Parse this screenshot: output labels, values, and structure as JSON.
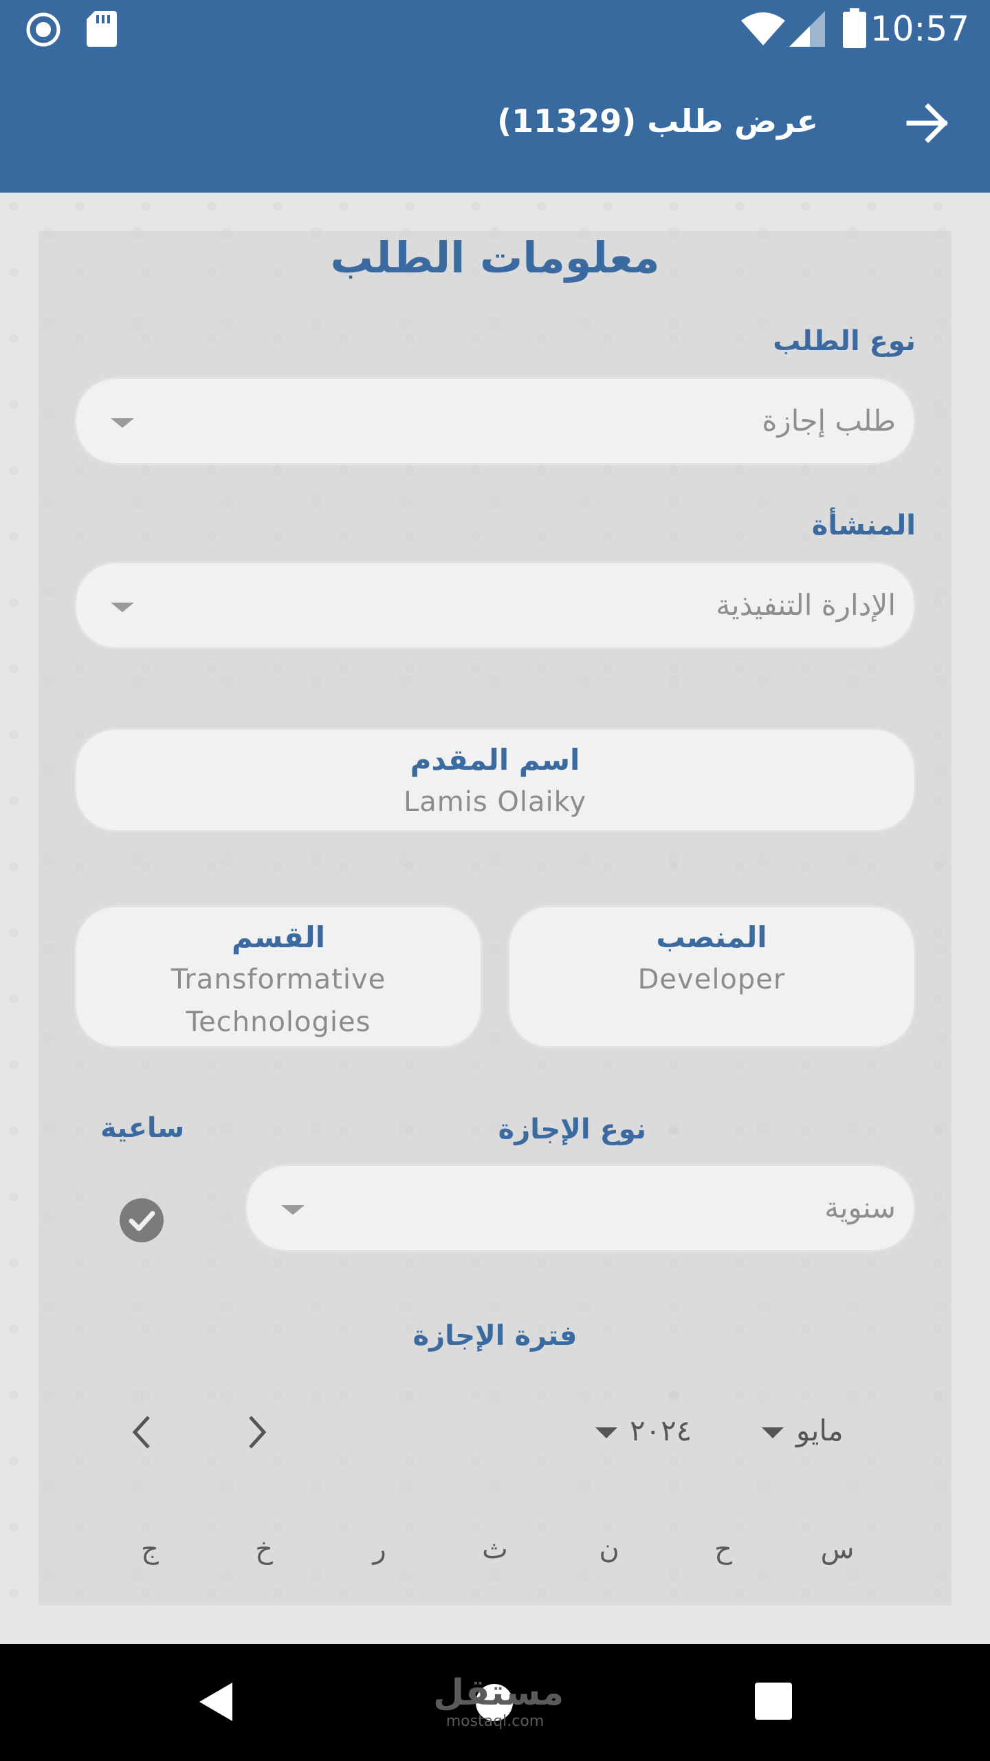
{
  "status_bar": {
    "time": "10:57",
    "icons": [
      "record-icon",
      "sd-card-icon",
      "wifi-icon",
      "signal-icon",
      "battery-icon"
    ]
  },
  "app_bar": {
    "title": "عرض طلب (11329)",
    "back_icon": "arrow-right-icon"
  },
  "form": {
    "title": "معلومات الطلب",
    "request_type": {
      "label": "نوع الطلب",
      "value": "طلب إجازة"
    },
    "facility": {
      "label": "المنشأة",
      "value": "الإدارة التنفيذية"
    },
    "applicant": {
      "label": "اسم المقدم",
      "value": "Lamis Olaiky"
    },
    "position": {
      "label": "المنصب",
      "value": "Developer"
    },
    "department": {
      "label": "القسم",
      "value_line1": "Transformative",
      "value_line2": "Technologies"
    },
    "leave_type": {
      "label": "نوع الإجازة",
      "value": "سنوية"
    },
    "hourly": {
      "label": "ساعية",
      "checked": true
    },
    "leave_period": {
      "label": "فترة الإجازة"
    }
  },
  "calendar": {
    "month": "مايو",
    "year": "٢٠٢٤",
    "weekdays": [
      "س",
      "ح",
      "ن",
      "ث",
      "ر",
      "خ",
      "ج"
    ]
  },
  "nav_bar": {
    "watermark_ar": "مستقل",
    "watermark_en": "mostaql.com"
  },
  "colors": {
    "primary": "#38699f",
    "label": "#3b6aa0",
    "field_bg": "#f1f1f1"
  }
}
